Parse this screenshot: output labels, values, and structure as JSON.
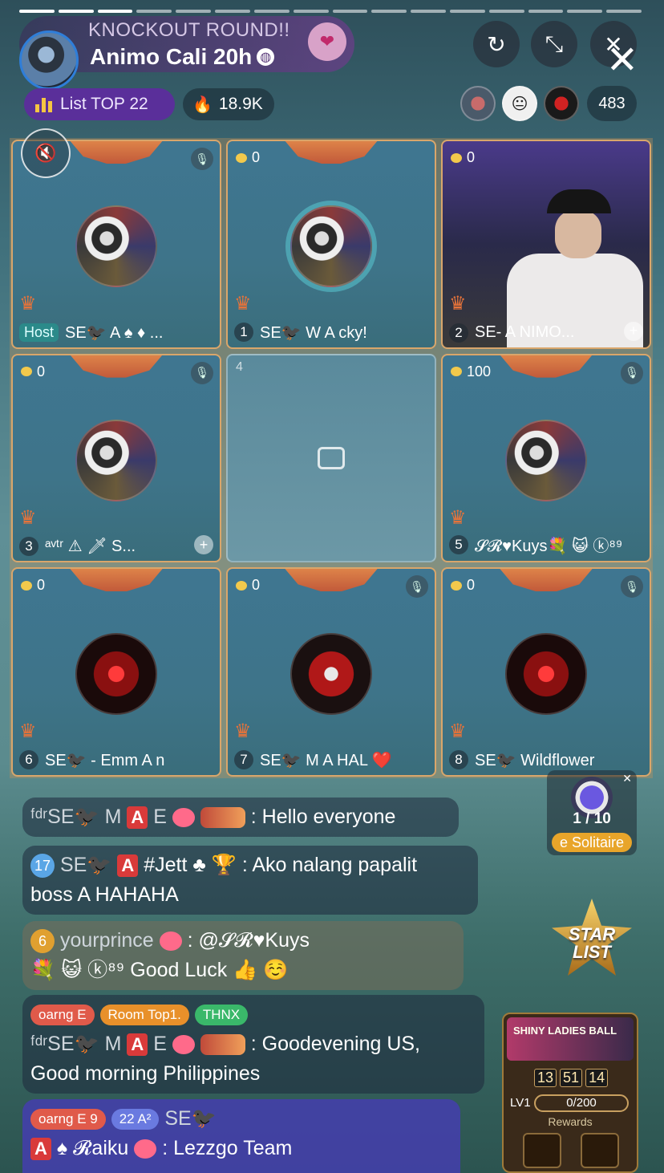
{
  "header": {
    "subtitle": "KNOCKOUT ROUND!!",
    "title": "Animo Cali 20h",
    "list_top": "List TOP 22",
    "popularity": "18.9K",
    "viewer_count": "483"
  },
  "seats": [
    {
      "index_label": "Host",
      "coins": "",
      "name": "SE🐦‍⬛ A ♠ ♦ ...",
      "muted": true
    },
    {
      "index_label": "1",
      "coins": "0",
      "name": "SE🐦‍⬛ W A cky!",
      "muted": false
    },
    {
      "index_label": "2",
      "coins": "0",
      "name": "SE- A NIMO...",
      "muted": false
    },
    {
      "index_label": "3",
      "coins": "0",
      "name": "ᵃᵛᵗʳ ⚠ 🗡 S...",
      "muted": true
    },
    {
      "index_label": "4",
      "coins": "",
      "name": "",
      "muted": false
    },
    {
      "index_label": "5",
      "coins": "100",
      "name": "𝓢𝓡♥Kuys💐 😺 ⓚ⁸⁹",
      "muted": true
    },
    {
      "index_label": "6",
      "coins": "0",
      "name": "SE🐦‍⬛ - Emm A n",
      "muted": false
    },
    {
      "index_label": "7",
      "coins": "0",
      "name": "SE🐦‍⬛ M A HAL ❤️",
      "muted": true
    },
    {
      "index_label": "8",
      "coins": "0",
      "name": "SE🐦‍⬛ Wildflower",
      "muted": true
    }
  ],
  "chat": {
    "m1_sender": "ᶠᵈʳSE🐦‍⬛ M",
    "m1_sender_suffix": "E",
    "m1_text": ": Hello everyone",
    "m2_level": "17",
    "m2_sender": "SE🐦‍⬛",
    "m2_sender_suffix": "#Jett ♣ 🏆",
    "m2_text": ": Ako nalang papalit",
    "m2_text2": "boss A HAHAHA",
    "m3_sender": "yourprince",
    "m3_text": ": @𝓢𝓡♥Kuys",
    "m3_text2": "💐 😺 ⓚ⁸⁹ Good Luck 👍 ☺️",
    "m4_tag1": "oarng E",
    "m4_tag2": "Room Top1.",
    "m4_tag3": "THNX",
    "m4_sender": "ᶠᵈʳSE🐦‍⬛ M",
    "m4_sender_suffix": "E",
    "m4_text": ": Goodevening US,",
    "m4_text2": "Good morning Philippines",
    "m5_tag1": "oarng E 9",
    "m5_tag2": "22 A²",
    "m5_sender": "SE🐦‍⬛",
    "m5_sender2": "♠ 𝓡aiku",
    "m5_text": ": Lezzgo Team"
  },
  "side": {
    "solitaire_progress": "1 / 10",
    "solitaire_name": "e Solitaire",
    "star_list": "STAR LIST",
    "event_title": "SHINY LADIES BALL",
    "timer_h": "13",
    "timer_m": "51",
    "timer_s": "14",
    "event_level": "LV1",
    "event_progress": "0/200",
    "event_rewards": "Rewards"
  }
}
